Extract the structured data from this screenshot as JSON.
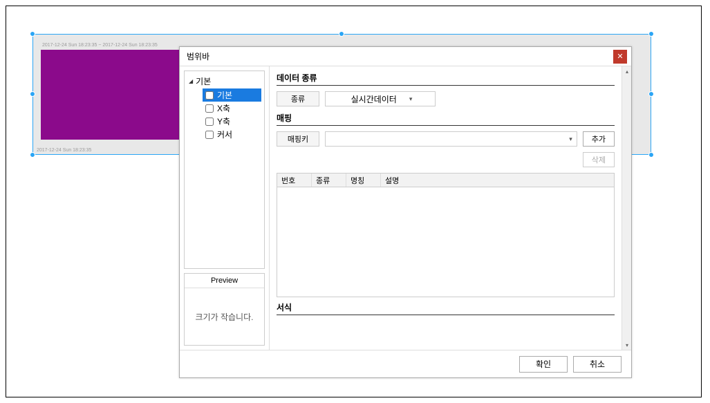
{
  "designer": {
    "timestamp_top": "2017-12-24 Sun 18:23:35 ~ 2017-12-24 Sun 18:23:35",
    "timestamp_bottom": "2017-12-24 Sun\n18:23:35"
  },
  "dialog": {
    "title": "범위바",
    "tree": {
      "root": "기본",
      "items": [
        {
          "label": "기본",
          "selected": true
        },
        {
          "label": "X축",
          "selected": false
        },
        {
          "label": "Y축",
          "selected": false
        },
        {
          "label": "커서",
          "selected": false
        }
      ]
    },
    "preview": {
      "title": "Preview",
      "message": "크기가 작습니다."
    },
    "sections": {
      "data_kind_heading": "데이터 종류",
      "kind_label": "종류",
      "kind_value": "실시간데이터",
      "mapping_heading": "매핑",
      "mapping_key_label": "매핑키",
      "mapping_key_value": "",
      "add_btn": "추가",
      "del_btn": "삭제",
      "grid_headers": {
        "no": "번호",
        "kind": "종류",
        "name": "명칭",
        "desc": "설명"
      },
      "format_heading": "서식"
    },
    "footer": {
      "ok": "확인",
      "cancel": "취소"
    }
  }
}
